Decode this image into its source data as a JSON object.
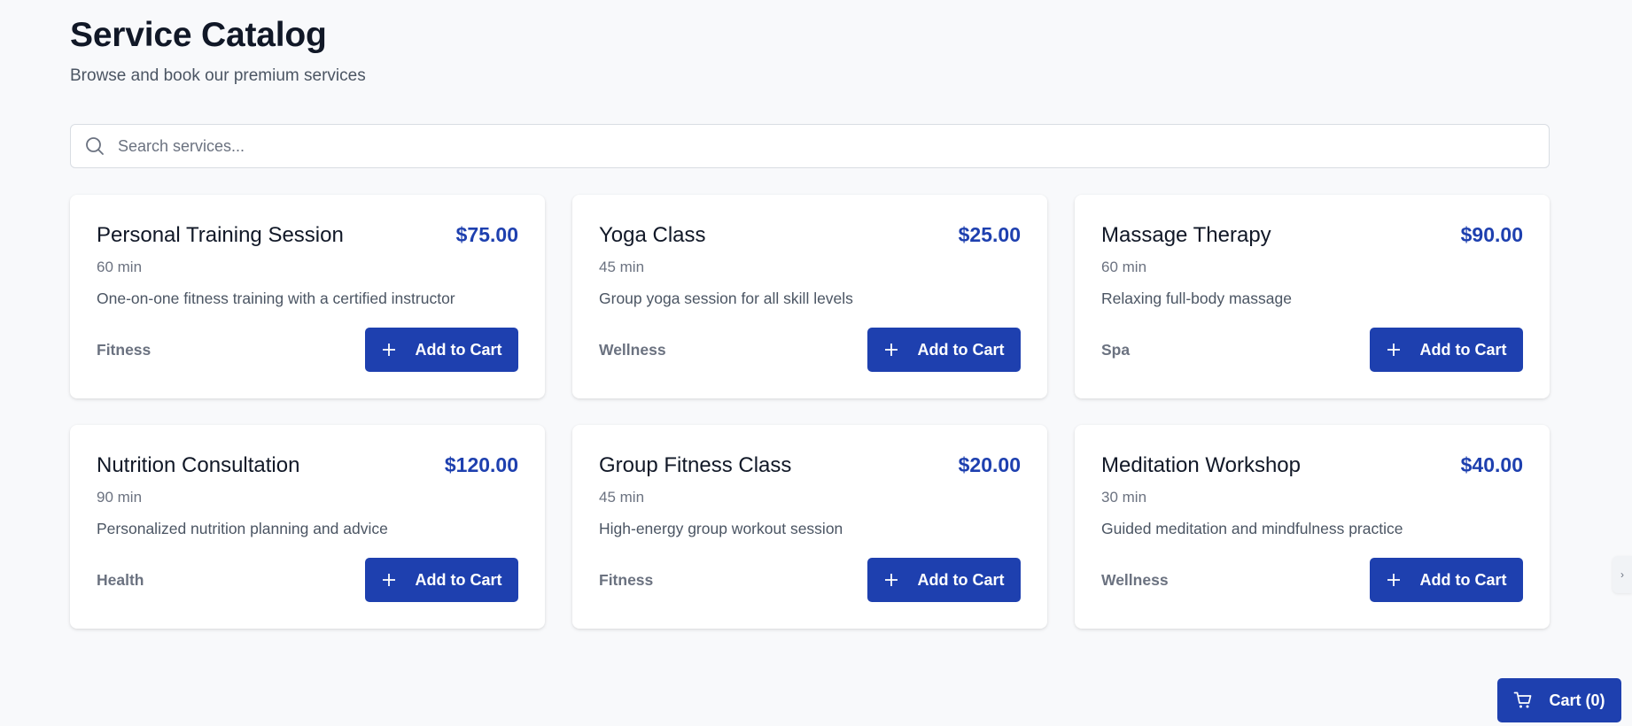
{
  "header": {
    "title": "Service Catalog",
    "subtitle": "Browse and book our premium services"
  },
  "search": {
    "placeholder": "Search services...",
    "value": "",
    "icon": "search-icon"
  },
  "colors": {
    "accent": "#1e40af",
    "background": "#f8f9fb",
    "card": "#ffffff",
    "muted_text": "#6b7280"
  },
  "services": [
    {
      "name": "Personal Training Session",
      "price": "$75.00",
      "duration": "60 min",
      "description": "One-on-one fitness training with a certified instructor",
      "category": "Fitness",
      "button_label": "Add to Cart",
      "button_icon": "plus-icon"
    },
    {
      "name": "Yoga Class",
      "price": "$25.00",
      "duration": "45 min",
      "description": "Group yoga session for all skill levels",
      "category": "Wellness",
      "button_label": "Add to Cart",
      "button_icon": "plus-icon"
    },
    {
      "name": "Massage Therapy",
      "price": "$90.00",
      "duration": "60 min",
      "description": "Relaxing full-body massage",
      "category": "Spa",
      "button_label": "Add to Cart",
      "button_icon": "plus-icon"
    },
    {
      "name": "Nutrition Consultation",
      "price": "$120.00",
      "duration": "90 min",
      "description": "Personalized nutrition planning and advice",
      "category": "Health",
      "button_label": "Add to Cart",
      "button_icon": "plus-icon"
    },
    {
      "name": "Group Fitness Class",
      "price": "$20.00",
      "duration": "45 min",
      "description": "High-energy group workout session",
      "category": "Fitness",
      "button_label": "Add to Cart",
      "button_icon": "plus-icon"
    },
    {
      "name": "Meditation Workshop",
      "price": "$40.00",
      "duration": "30 min",
      "description": "Guided meditation and mindfulness practice",
      "category": "Wellness",
      "button_label": "Add to Cart",
      "button_icon": "plus-icon"
    }
  ],
  "cart": {
    "label": "Cart (0)",
    "icon": "cart-icon"
  },
  "side_handle": {
    "glyph": "›",
    "icon": "chevron-right-icon"
  }
}
